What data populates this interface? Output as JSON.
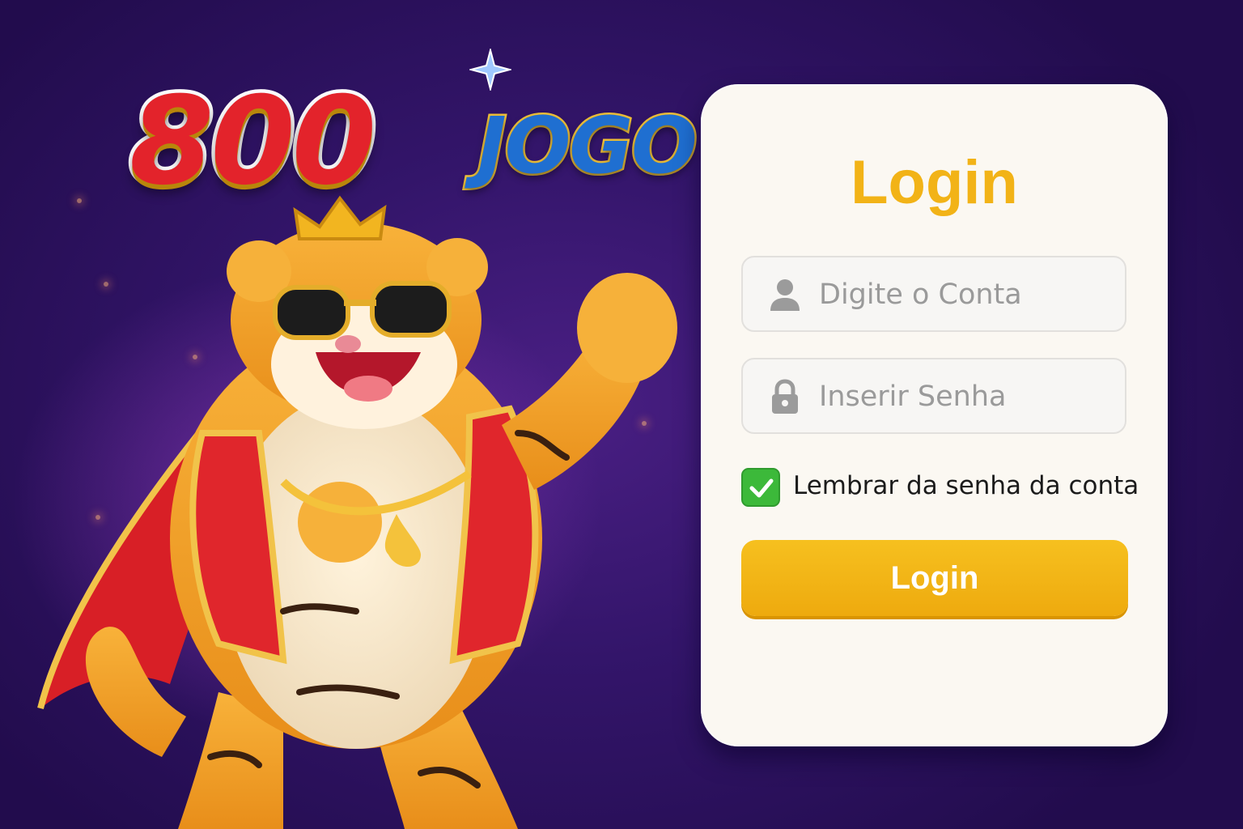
{
  "colors": {
    "background": "#33156a",
    "card": "#fbf8f2",
    "accent": "#f2b317",
    "checkbox": "#3cb93a",
    "logo_red": "#e3232b",
    "logo_blue": "#1f6fd1"
  },
  "brand": {
    "number": "800",
    "word": "JOGO"
  },
  "login": {
    "title": "Login",
    "account_field": {
      "placeholder": "Digite o Conta",
      "icon": "user-icon"
    },
    "password_field": {
      "placeholder": "Inserir Senha",
      "icon": "lock-icon"
    },
    "remember": {
      "label": "Lembrar da senha da conta",
      "checked": true,
      "icon": "checkmark-icon"
    },
    "button_label": "Login"
  },
  "mascot": {
    "icon": "tiger-king-mascot"
  }
}
